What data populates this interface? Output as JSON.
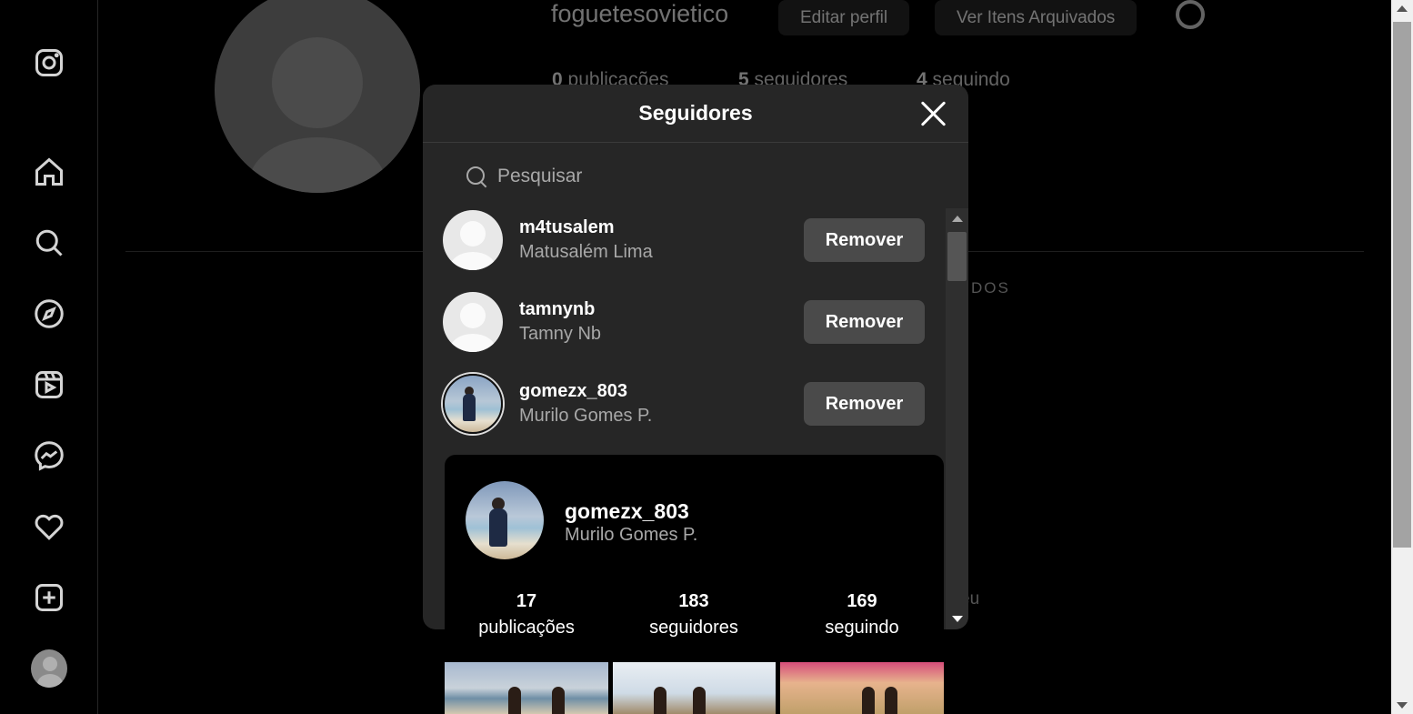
{
  "profile": {
    "username": "foguetesovietico",
    "edit_label": "Editar perfil",
    "archive_label": "Ver Itens Arquivados",
    "posts_count": "0",
    "posts_label": "publicações",
    "followers_count": "5",
    "followers_label": "seguidores",
    "following_count": "4",
    "following_label": "seguindo",
    "tab_tagged_fragment": "DOS",
    "text_fragment": "eu"
  },
  "sidebar": {
    "items": [
      {
        "icon": "instagram-logo-icon"
      },
      {
        "icon": "home-icon"
      },
      {
        "icon": "search-icon"
      },
      {
        "icon": "explore-icon"
      },
      {
        "icon": "reels-icon"
      },
      {
        "icon": "messenger-icon"
      },
      {
        "icon": "heart-icon"
      },
      {
        "icon": "create-icon"
      },
      {
        "icon": "profile-avatar"
      }
    ]
  },
  "modal": {
    "title": "Seguidores",
    "search_placeholder": "Pesquisar",
    "remove_label": "Remover",
    "followers": [
      {
        "username": "m4tusalem",
        "name": "Matusalém Lima"
      },
      {
        "username": "tamnynb",
        "name": "Tamny Nb"
      },
      {
        "username": "gomezx_803",
        "name": "Murilo Gomes P."
      }
    ]
  },
  "hover_card": {
    "username": "gomezx_803",
    "name": "Murilo Gomes P.",
    "posts_count": "17",
    "posts_label": "publicações",
    "followers_count": "183",
    "followers_label": "seguidores",
    "following_count": "169",
    "following_label": "seguindo"
  }
}
